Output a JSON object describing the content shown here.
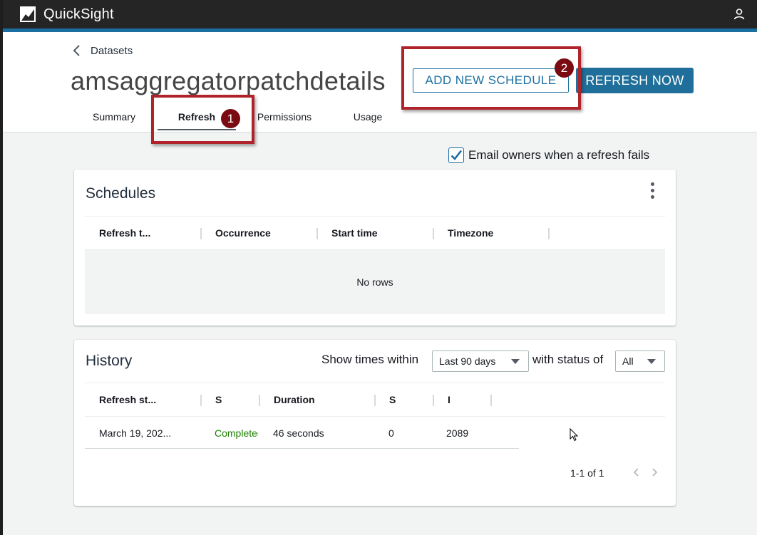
{
  "topbar": {
    "app_name": "QuickSight"
  },
  "breadcrumb": {
    "label": "Datasets"
  },
  "page": {
    "title": "amsaggregatorpatchdetails"
  },
  "tabs": [
    {
      "label": "Summary",
      "active": false
    },
    {
      "label": "Refresh",
      "active": true
    },
    {
      "label": "Permissions",
      "active": false
    },
    {
      "label": "Usage",
      "active": false
    }
  ],
  "buttons": {
    "add_schedule": "ADD NEW SCHEDULE",
    "refresh_now": "REFRESH NOW"
  },
  "annotations": {
    "badge_1": "1",
    "badge_2": "2"
  },
  "email_option": {
    "label": "Email owners when a refresh fails",
    "checked": true
  },
  "schedules": {
    "title": "Schedules",
    "columns": [
      "Refresh t...",
      "Occurrence",
      "Start time",
      "Timezone"
    ],
    "empty_text": "No rows"
  },
  "history": {
    "title": "History",
    "filter_label_1": "Show times within",
    "time_range": "Last 90 days",
    "filter_label_2": "with status of",
    "status_filter": "All",
    "columns": [
      "Refresh st...",
      "S",
      "Duration",
      "S",
      "I"
    ],
    "rows": [
      {
        "refresh_start": "March 19, 202...",
        "status": "Completed",
        "duration": "46 seconds",
        "skipped": "0",
        "ingested": "2089"
      }
    ],
    "pagination": "1-1 of 1"
  },
  "colors": {
    "accent": "#1b6fa0",
    "topbar": "#252525",
    "highlight": "#b0232a",
    "success": "#1d8102"
  }
}
